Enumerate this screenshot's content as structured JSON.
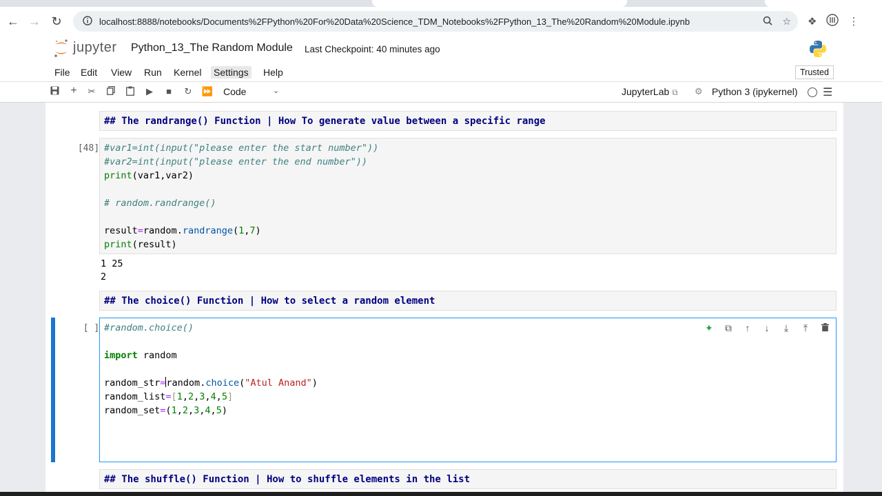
{
  "browser": {
    "url": "localhost:8888/notebooks/Documents%2FPython%20For%20Data%20Science_TDM_Notebooks%2FPython_13_The%20Random%20Module.ipynb"
  },
  "header": {
    "logo_text": "jupyter",
    "notebook_title": "Python_13_The Random Module",
    "checkpoint": "Last Checkpoint: 40 minutes ago"
  },
  "menu": {
    "items": [
      "File",
      "Edit",
      "View",
      "Run",
      "Kernel",
      "Settings",
      "Help"
    ],
    "active": "Settings",
    "trusted": "Trusted"
  },
  "toolbar": {
    "cell_type": "Code",
    "jupyterlab_label": "JupyterLab",
    "kernel_name": "Python 3 (ipykernel)"
  },
  "cells": {
    "md1": "## The randrange() Function | How To generate value between a specific range",
    "code1_prompt": "[48]:",
    "code1_lines": [
      "#var1=int(input(\"please enter the start number\"))",
      "#var2=int(input(\"please enter the end number\"))",
      "print(var1,var2)",
      "",
      "# random.randrange()",
      "",
      "result=random.randrange(1,7)",
      "print(result)"
    ],
    "code1_output": [
      "1 25",
      "2"
    ],
    "md2": "## The choice() Function | How to select a random element",
    "code2_prompt": "[ ]:",
    "code2_lines": [
      "#random.choice()",
      "",
      "import random",
      "",
      "random_str=random.choice(\"Atul Anand\")",
      "random_list=[1,2,3,4,5]",
      "random_set=(1,2,3,4,5)"
    ],
    "md3": "## The shuffle() Function | How to shuffle elements in the list"
  },
  "colors": {
    "accent": "#1976d2",
    "markdown_heading": "#000080",
    "comment": "#408080",
    "keyword": "#008000",
    "string": "#ba2121"
  }
}
